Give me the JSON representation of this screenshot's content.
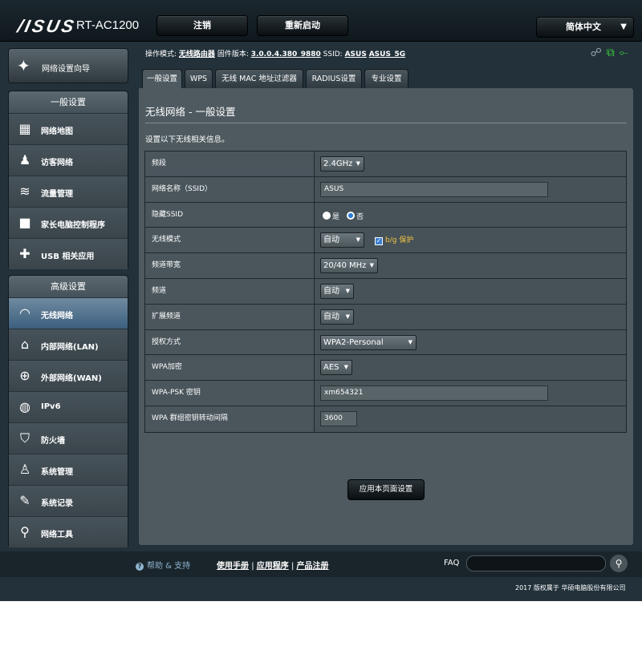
{
  "header": {
    "logo": "/ISUS",
    "model": "RT-AC1200",
    "logout": "注销",
    "reboot": "重新启动",
    "language": "简体中文"
  },
  "wizard": {
    "label": "网络设置向导"
  },
  "sidebar": {
    "basic_title": "一般设置",
    "basic_items": [
      {
        "label": "网络地图"
      },
      {
        "label": "访客网络"
      },
      {
        "label": "流量管理"
      },
      {
        "label": "家长电脑控制程序"
      },
      {
        "label": "USB 相关应用"
      }
    ],
    "advanced_title": "高级设置",
    "advanced_items": [
      {
        "label": "无线网络"
      },
      {
        "label": "内部网络(LAN)"
      },
      {
        "label": "外部网络(WAN)"
      },
      {
        "label": "IPv6"
      },
      {
        "label": "防火墙"
      },
      {
        "label": "系统管理"
      },
      {
        "label": "系统记录"
      },
      {
        "label": "网络工具"
      }
    ]
  },
  "opinfo": {
    "mode_label": "操作模式:",
    "mode_value": "无线路由器",
    "fw_label": "固件版本:",
    "fw_value": "3.0.0.4.380_9880",
    "ssid_label": "SSID:",
    "ssid_1": "ASUS",
    "ssid_2": "ASUS_5G"
  },
  "tabs": [
    "一般设置",
    "WPS",
    "无线 MAC 地址过滤器",
    "RADIUS设置",
    "专业设置"
  ],
  "panel": {
    "title": "无线网络 - 一般设置",
    "description": "设置以下无线相关信息。"
  },
  "settings": {
    "band": {
      "label": "频段",
      "value": "2.4GHz"
    },
    "ssid": {
      "label": "网络名称（SSID）",
      "value": "ASUS"
    },
    "hide_ssid": {
      "label": "隐藏SSID",
      "opt_yes": "是",
      "opt_no": "否",
      "selected": "否"
    },
    "wireless_mode": {
      "label": "无线模式",
      "value": "自动",
      "checkbox": "b/g 保护"
    },
    "bandwidth": {
      "label": "频道带宽",
      "value": "20/40 MHz"
    },
    "channel": {
      "label": "频道",
      "value": "自动"
    },
    "ext_channel": {
      "label": "扩展频道",
      "value": "自动"
    },
    "auth": {
      "label": "授权方式",
      "value": "WPA2-Personal"
    },
    "wpa_enc": {
      "label": "WPA加密",
      "value": "AES"
    },
    "psk": {
      "label": "WPA-PSK 密钥",
      "value": "xm654321"
    },
    "rekey": {
      "label": "WPA 群组密钥转动间隔",
      "value": "3600"
    }
  },
  "apply_label": "应用本页面设置",
  "footer": {
    "help": "帮助 & 支持",
    "manual": "使用手册",
    "sep1": "|",
    "utility": "应用程序",
    "sep2": "|",
    "register": "产品注册",
    "faq": "FAQ",
    "copyright": "2017 版权属于 华硕电脑股份有限公司"
  },
  "colors": {
    "accent": "#3c80d0",
    "highlight": "#f5c542",
    "active_nav": "#4e7393"
  }
}
